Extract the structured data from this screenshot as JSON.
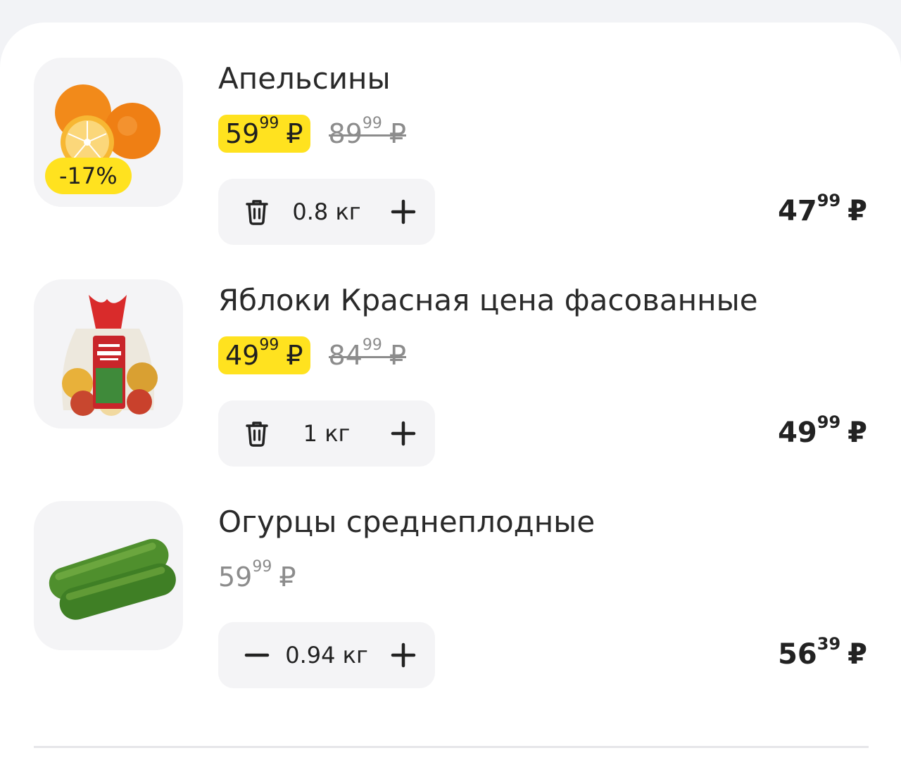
{
  "cart": {
    "items": [
      {
        "name": "Апельсины",
        "discount_badge": "-17%",
        "price_main": "59",
        "price_kop": "99",
        "old_main": "89",
        "old_kop": "99",
        "currency": "₽",
        "quantity": "0.8 кг",
        "total_main": "47",
        "total_kop": "99",
        "left_icon": "trash-icon",
        "right_icon": "plus-icon"
      },
      {
        "name": "Яблоки Красная цена фасованные",
        "price_main": "49",
        "price_kop": "99",
        "old_main": "84",
        "old_kop": "99",
        "currency": "₽",
        "quantity": "1 кг",
        "total_main": "49",
        "total_kop": "99",
        "left_icon": "trash-icon",
        "right_icon": "plus-icon"
      },
      {
        "name": "Огурцы среднеплодные",
        "price_main": "59",
        "price_kop": "99",
        "currency": "₽",
        "quantity": "0.94 кг",
        "total_main": "56",
        "total_kop": "39",
        "left_icon": "minus-icon",
        "right_icon": "plus-icon"
      }
    ]
  },
  "colors": {
    "accent_yellow": "#ffe21f",
    "card_bg": "#f4f4f6",
    "text_main": "#1f1f1f",
    "text_muted": "#8c8c8c"
  }
}
